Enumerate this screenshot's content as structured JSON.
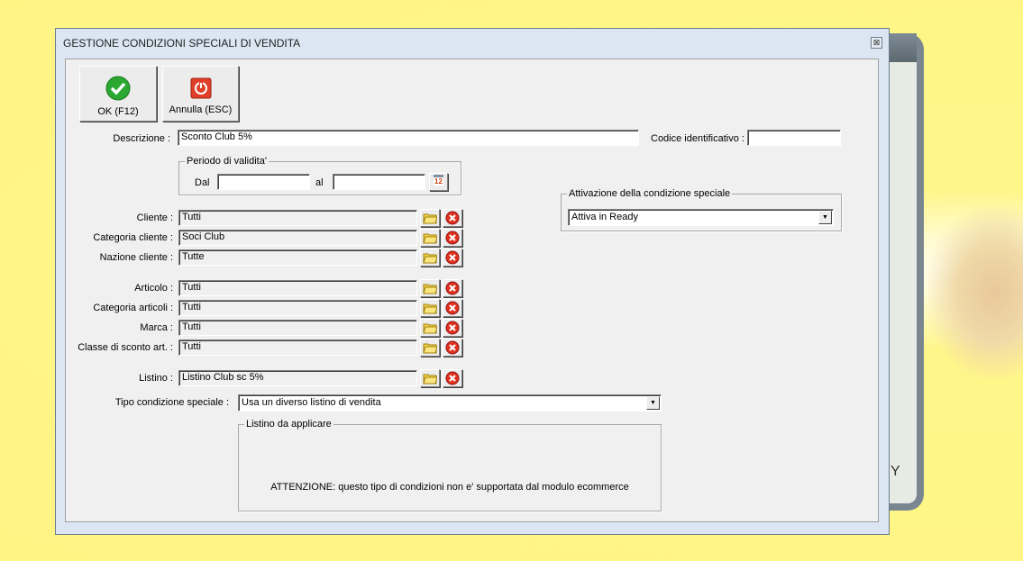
{
  "window": {
    "title": "GESTIONE CONDIZIONI SPECIALI DI VENDITA",
    "close_glyph": "⊠"
  },
  "background": {
    "letter": "Y"
  },
  "toolbar": {
    "ok_label": "OK (F12)",
    "cancel_label": "Annulla (ESC)"
  },
  "descrizione": {
    "label": "Descrizione :",
    "value": "Sconto Club 5%"
  },
  "codice": {
    "label": "Codice identificativo :",
    "value": ""
  },
  "periodo": {
    "legend": "Periodo di validita'",
    "dal_label": "Dal",
    "dal_value": "",
    "al_label": "al",
    "al_value": "",
    "calendar_text": "12"
  },
  "attivazione": {
    "legend": "Attivazione della condizione speciale",
    "value": "Attiva in Ready"
  },
  "fields": [
    {
      "label": "Cliente :",
      "value": "Tutti"
    },
    {
      "label": "Categoria cliente :",
      "value": "Soci Club"
    },
    {
      "label": "Nazione cliente :",
      "value": "Tutte"
    },
    {
      "label": "Articolo :",
      "value": "Tutti"
    },
    {
      "label": "Categoria articoli :",
      "value": "Tutti"
    },
    {
      "label": "Marca :",
      "value": "Tutti"
    },
    {
      "label": "Classe di sconto art. :",
      "value": "Tutti"
    },
    {
      "label": "Listino :",
      "value": "Listino Club sc 5%"
    }
  ],
  "tipo": {
    "label": "Tipo condizione speciale :",
    "value": "Usa un diverso listino di vendita"
  },
  "listino_applicare": {
    "legend": "Listino da applicare",
    "warning": "ATTENZIONE: questo tipo di condizioni non e' supportata dal modulo ecommerce"
  }
}
